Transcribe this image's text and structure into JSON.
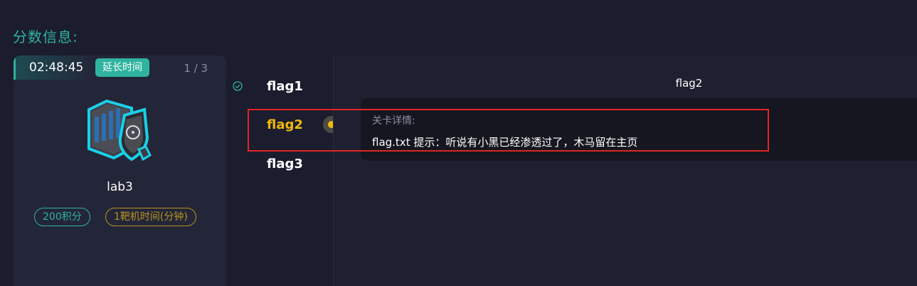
{
  "section": {
    "title": "分数信息:"
  },
  "card": {
    "timer": "02:48:45",
    "extend_label": "延长时间",
    "page": "1 / 3",
    "lab_name": "lab3",
    "score_tag": "200积分",
    "time_tag": "1靶机时间(分钟)"
  },
  "flags": [
    {
      "label": "flag1",
      "status": "completed"
    },
    {
      "label": "flag2",
      "status": "current"
    },
    {
      "label": "flag3",
      "status": "pending"
    }
  ],
  "detail": {
    "title": "flag2",
    "label": "关卡详情:",
    "text": "flag.txt 提示：听说有小黑已经渗透过了，木马留在主页"
  },
  "colors": {
    "accent": "#2fb3a0",
    "active": "#f0b90a",
    "highlight": "#e02424"
  }
}
